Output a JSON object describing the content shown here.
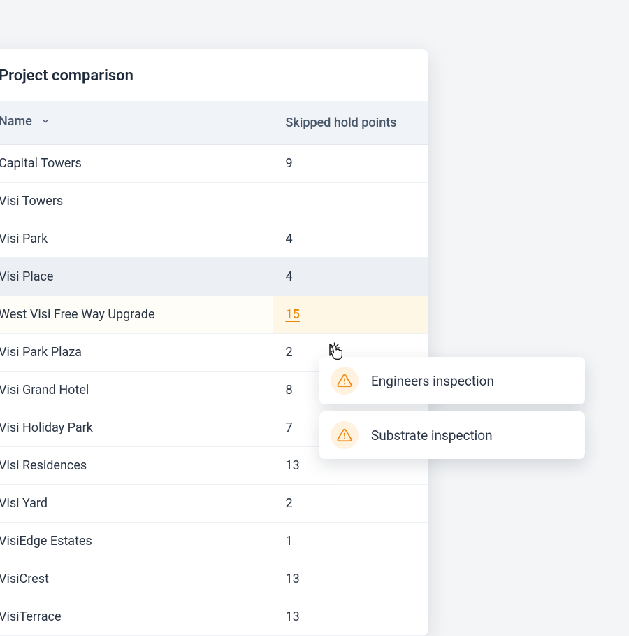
{
  "card": {
    "title": "Project comparison"
  },
  "columns": {
    "name": "Name",
    "points": "Skipped hold points"
  },
  "rows": [
    {
      "name": "Capital Towers",
      "points": "9",
      "shaded": false,
      "highlight": false,
      "link": false
    },
    {
      "name": "Visi Towers",
      "points": "",
      "shaded": false,
      "highlight": false,
      "link": false
    },
    {
      "name": "Visi Park",
      "points": "4",
      "shaded": false,
      "highlight": false,
      "link": false
    },
    {
      "name": "Visi Place",
      "points": "4",
      "shaded": true,
      "highlight": false,
      "link": false
    },
    {
      "name": "West Visi Free Way Upgrade",
      "points": "15",
      "shaded": false,
      "highlight": true,
      "link": true
    },
    {
      "name": "Visi Park Plaza",
      "points": "2",
      "shaded": false,
      "highlight": false,
      "link": false
    },
    {
      "name": "Visi Grand Hotel",
      "points": "8",
      "shaded": false,
      "highlight": false,
      "link": false
    },
    {
      "name": "Visi Holiday Park",
      "points": "7",
      "shaded": false,
      "highlight": false,
      "link": false
    },
    {
      "name": "Visi Residences",
      "points": "13",
      "shaded": false,
      "highlight": false,
      "link": false
    },
    {
      "name": "Visi Yard",
      "points": "2",
      "shaded": false,
      "highlight": false,
      "link": false
    },
    {
      "name": "VisiEdge Estates",
      "points": "1",
      "shaded": false,
      "highlight": false,
      "link": false
    },
    {
      "name": "VisiCrest",
      "points": "13",
      "shaded": false,
      "highlight": false,
      "link": false
    },
    {
      "name": "VisiTerrace",
      "points": "13",
      "shaded": false,
      "highlight": false,
      "link": false
    }
  ],
  "popovers": [
    {
      "label": "Engineers inspection"
    },
    {
      "label": "Substrate inspection"
    }
  ]
}
